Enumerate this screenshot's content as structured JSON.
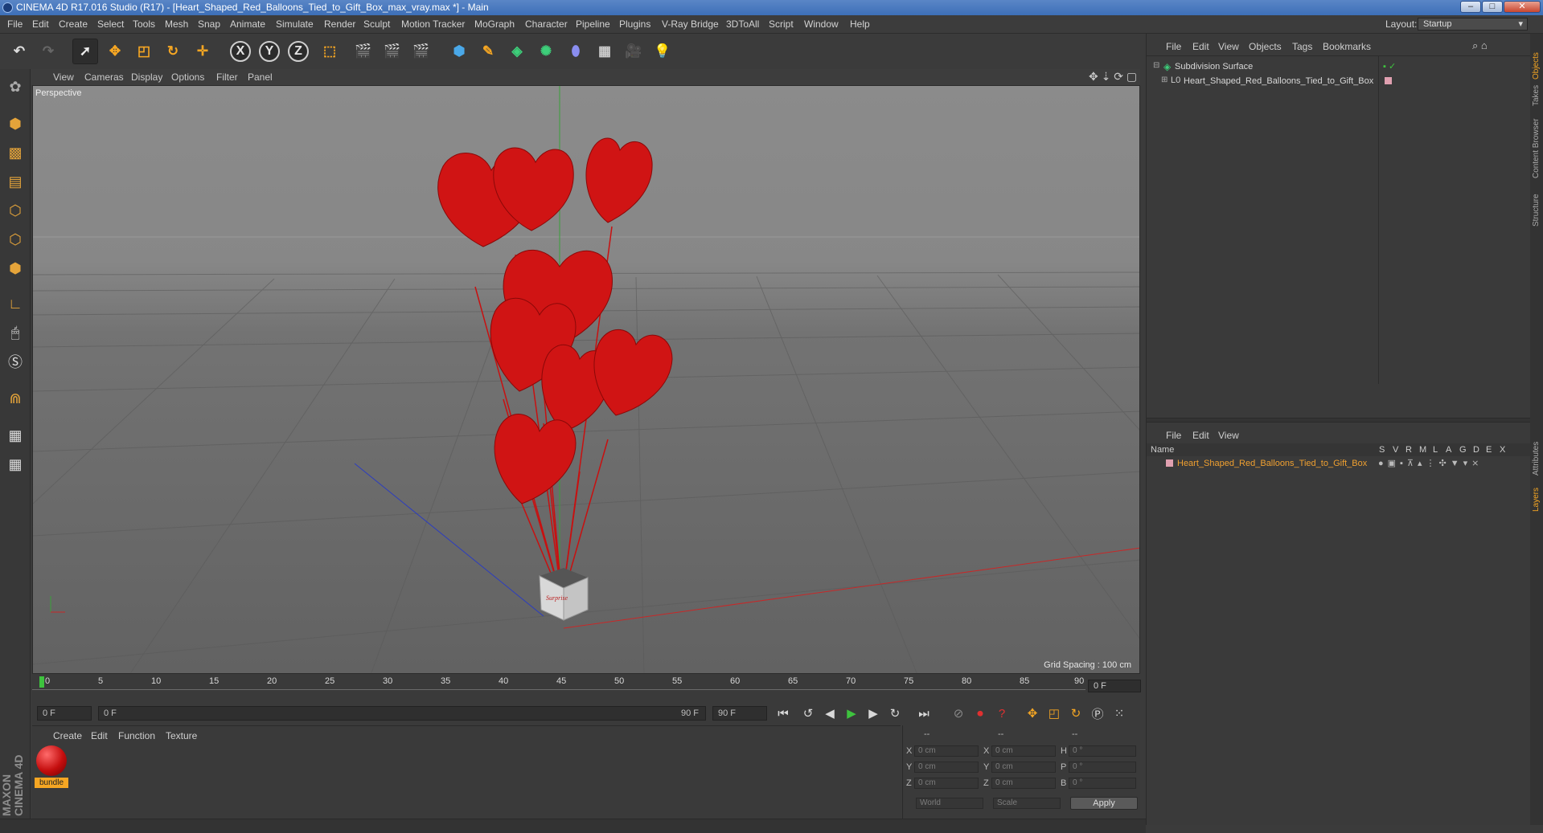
{
  "window": {
    "title": "CINEMA 4D R17.016 Studio (R17) - [Heart_Shaped_Red_Balloons_Tied_to_Gift_Box_max_vray.max *] - Main"
  },
  "menubar": {
    "items": [
      "File",
      "Edit",
      "Create",
      "Select",
      "Tools",
      "Mesh",
      "Snap",
      "Animate",
      "Simulate",
      "Render",
      "Sculpt",
      "Motion Tracker",
      "MoGraph",
      "Character",
      "Pipeline",
      "Plugins",
      "V-Ray Bridge",
      "3DToAll",
      "Script",
      "Window",
      "Help"
    ],
    "layout_label": "Layout:",
    "layout_value": "Startup"
  },
  "toolbar": {
    "x_axis": "X",
    "y_axis": "Y",
    "z_axis": "Z"
  },
  "viewport": {
    "menu": [
      "View",
      "Cameras",
      "Display",
      "Options",
      "Filter",
      "Panel"
    ],
    "label": "Perspective",
    "grid_spacing": "Grid Spacing : 100 cm",
    "box_text": "Surprise"
  },
  "timeline": {
    "ticks": [
      "0",
      "5",
      "10",
      "15",
      "20",
      "25",
      "30",
      "35",
      "40",
      "45",
      "50",
      "55",
      "60",
      "65",
      "70",
      "75",
      "80",
      "85",
      "90"
    ],
    "current_frame": "0 F"
  },
  "transport": {
    "start_field": "0 F",
    "range_start": "0 F",
    "range_end": "90 F",
    "end_field": "90 F"
  },
  "materials": {
    "menu": [
      "Create",
      "Edit",
      "Function",
      "Texture"
    ],
    "material_name": "bundle"
  },
  "coords": {
    "headers": [
      "--",
      "--",
      "--"
    ],
    "rows": [
      {
        "a": "X",
        "av": "0 cm",
        "b": "X",
        "bv": "0 cm",
        "c": "H",
        "cv": "0 °"
      },
      {
        "a": "Y",
        "av": "0 cm",
        "b": "Y",
        "bv": "0 cm",
        "c": "P",
        "cv": "0 °"
      },
      {
        "a": "Z",
        "av": "0 cm",
        "b": "Z",
        "bv": "0 cm",
        "c": "B",
        "cv": "0 °"
      }
    ],
    "world": "World",
    "scale": "Scale",
    "apply": "Apply"
  },
  "object_manager": {
    "menu": [
      "File",
      "Edit",
      "View",
      "Objects",
      "Tags",
      "Bookmarks"
    ],
    "objects": [
      "Subdivision Surface",
      "Heart_Shaped_Red_Balloons_Tied_to_Gift_Box"
    ]
  },
  "layer_manager": {
    "menu": [
      "File",
      "Edit",
      "View"
    ],
    "name_header": "Name",
    "columns": [
      "S",
      "V",
      "R",
      "M",
      "L",
      "A",
      "G",
      "D",
      "E",
      "X"
    ],
    "layer": "Heart_Shaped_Red_Balloons_Tied_to_Gift_Box"
  },
  "side_tabs": [
    "Objects",
    "Takes",
    "Content Browser",
    "Structure",
    "Attributes",
    "Layers"
  ],
  "branding": {
    "logo": "MAXON CINEMA 4D"
  },
  "colors": {
    "accent": "#f5a623",
    "balloon": "#d01414",
    "layer_text": "#f0a030"
  }
}
